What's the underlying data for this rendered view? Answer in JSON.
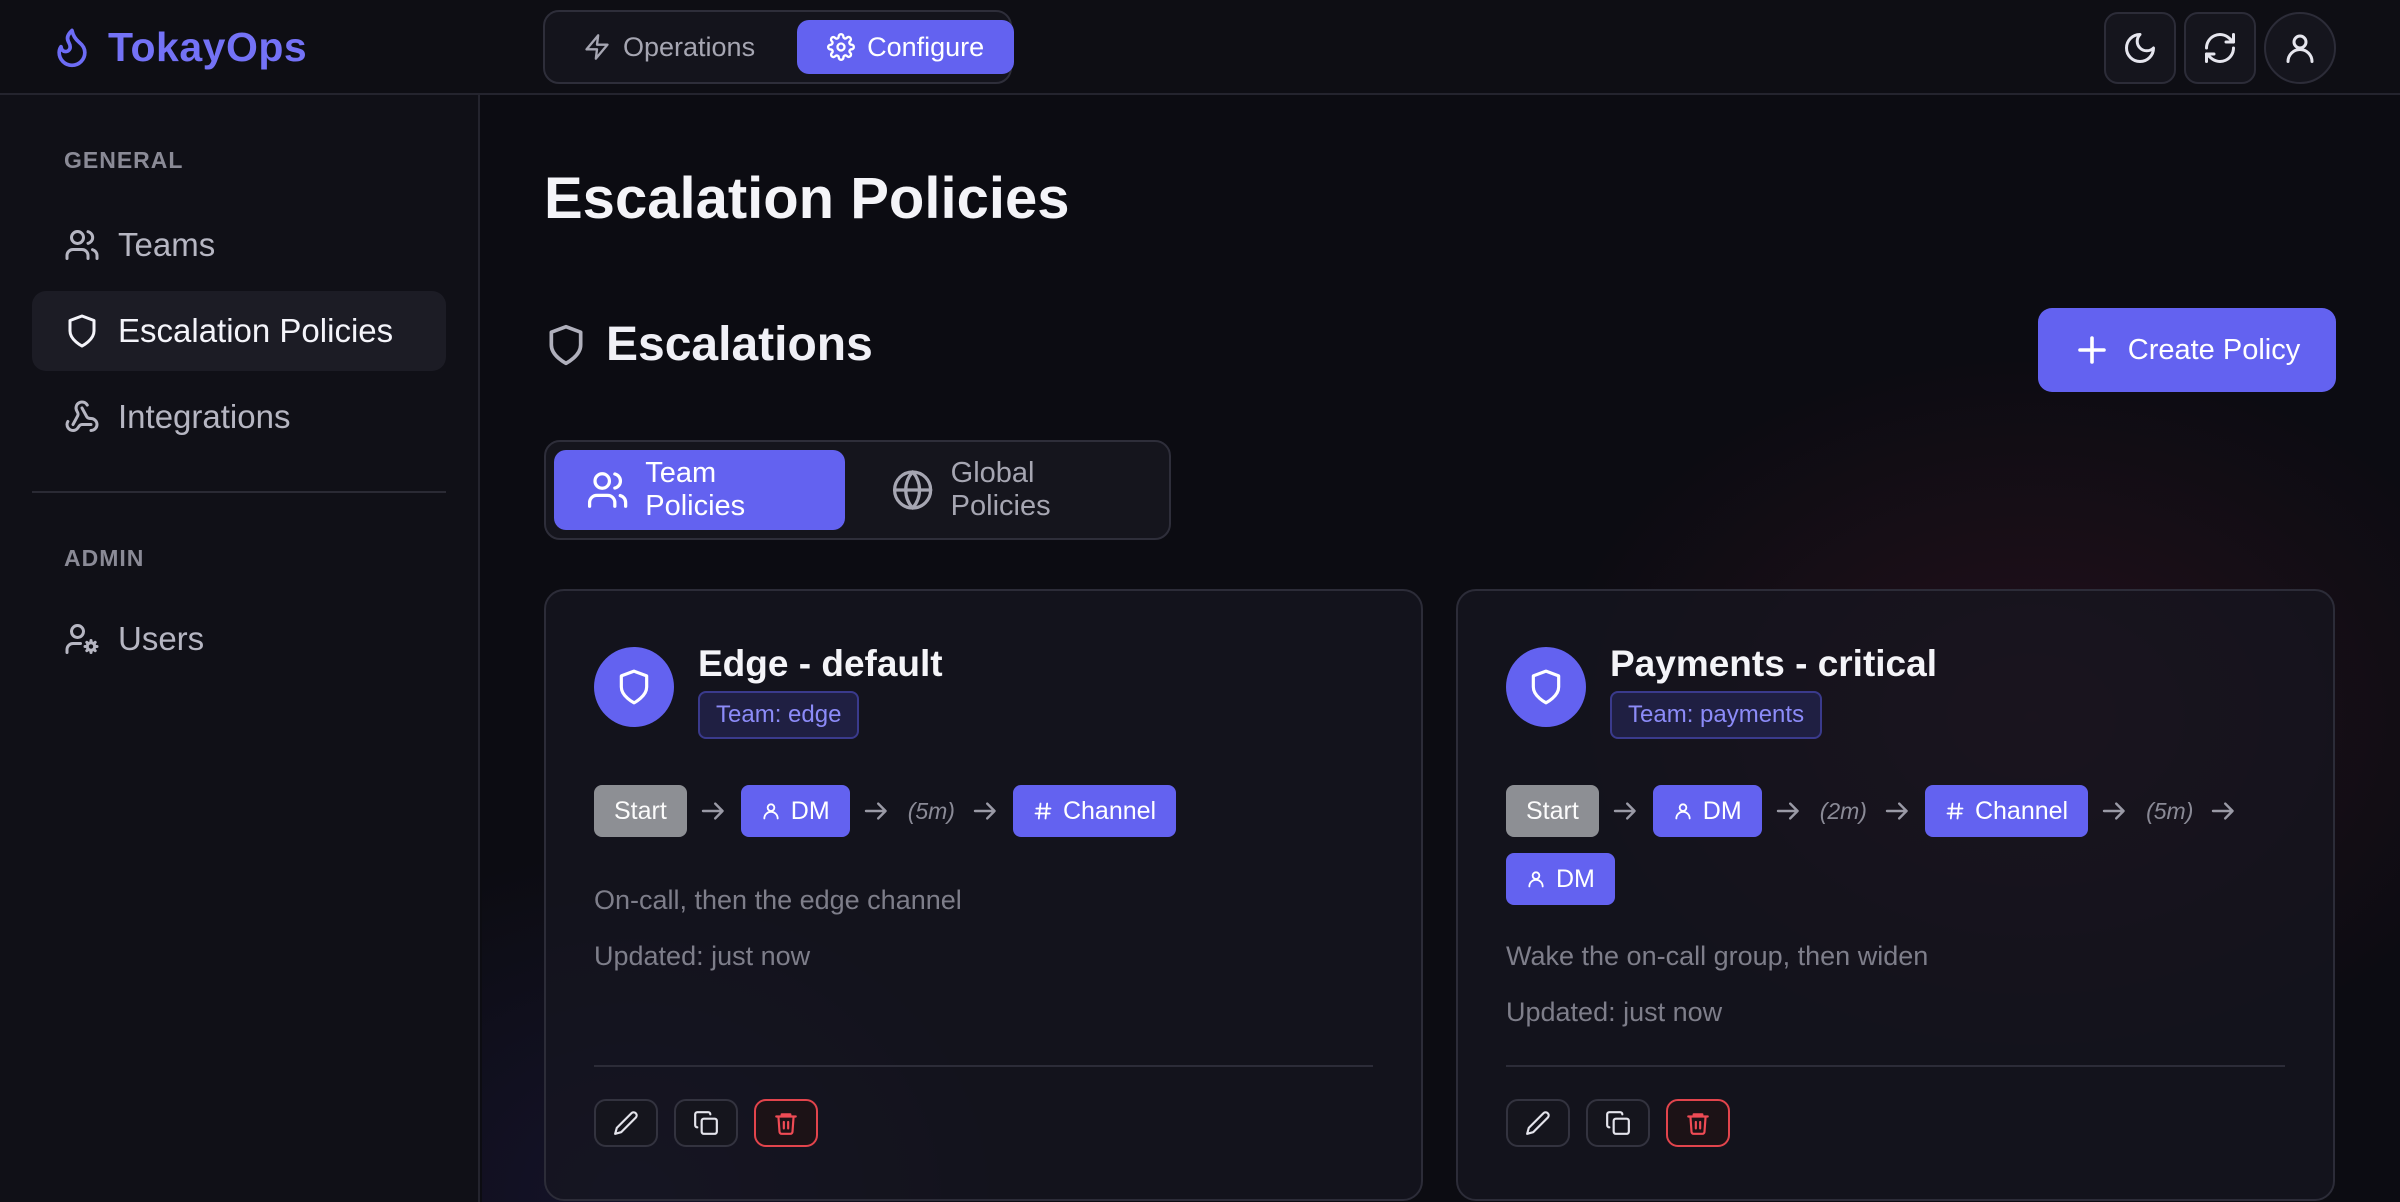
{
  "app": {
    "name": "TokayOps"
  },
  "modes": [
    {
      "label": "Operations",
      "icon": "bolt-icon",
      "active": false
    },
    {
      "label": "Configure",
      "icon": "gear-icon",
      "active": true
    }
  ],
  "top_actions": [
    "moon-icon",
    "refresh-icon",
    "user-icon"
  ],
  "sidebar": {
    "sections": [
      {
        "label": "GENERAL",
        "items": [
          {
            "label": "Teams",
            "icon": "users-icon",
            "active": false
          },
          {
            "label": "Escalation Policies",
            "icon": "shield-icon",
            "active": true
          },
          {
            "label": "Integrations",
            "icon": "webhook-icon",
            "active": false
          }
        ]
      },
      {
        "label": "ADMIN",
        "items": [
          {
            "label": "Users",
            "icon": "user-cog-icon",
            "active": false
          }
        ]
      }
    ]
  },
  "main": {
    "title": "Escalation Policies",
    "section_title": "Escalations",
    "create_label": "Create Policy",
    "tabs": [
      {
        "label": "Team Policies",
        "icon": "users-icon",
        "active": true
      },
      {
        "label": "Global Policies",
        "icon": "globe-icon",
        "active": false
      }
    ],
    "policies": [
      {
        "name": "Edge - default",
        "team": "Team: edge",
        "description": "On-call, then the edge channel",
        "updated": "Updated: just now",
        "steps": [
          "Start",
          "DM",
          "(5m)",
          "Channel"
        ]
      },
      {
        "name": "Payments - critical",
        "team": "Team: payments",
        "description": "Wake the on-call group, then widen",
        "updated": "Updated: just now",
        "steps": [
          "Start",
          "DM",
          "(2m)",
          "Channel",
          "(5m)",
          "DM"
        ]
      }
    ]
  },
  "colors": {
    "accent": "#6362f0",
    "brand": "#7472f6",
    "danger": "#ef4b55",
    "background": "#0c0c12"
  }
}
